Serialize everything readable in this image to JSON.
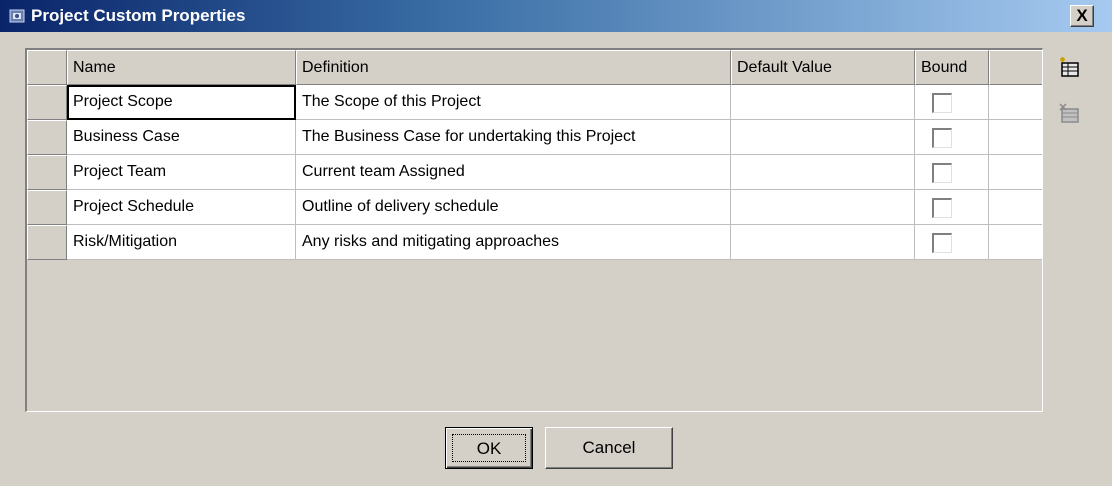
{
  "window": {
    "title": "Project Custom Properties",
    "close_label": "X"
  },
  "table": {
    "columns": [
      "Name",
      "Definition",
      "Default Value",
      "Bound"
    ],
    "rows": [
      {
        "name": "Project Scope",
        "definition": "The Scope of this Project",
        "default_value": "",
        "bound": false
      },
      {
        "name": "Business Case",
        "definition": "The Business Case for undertaking this Project",
        "default_value": "",
        "bound": false
      },
      {
        "name": "Project Team",
        "definition": "Current team Assigned",
        "default_value": "",
        "bound": false
      },
      {
        "name": "Project Schedule",
        "definition": "Outline of delivery schedule",
        "default_value": "",
        "bound": false
      },
      {
        "name": "Risk/Mitigation",
        "definition": "Any risks and mitigating approaches",
        "default_value": "",
        "bound": false
      }
    ]
  },
  "side_toolbar": {
    "add_icon": "add-property-icon",
    "delete_icon": "delete-property-icon"
  },
  "buttons": {
    "ok_label": "OK",
    "cancel_label": "Cancel"
  },
  "colors": {
    "dialog_bg": "#d4d0c8",
    "title_gradient_start": "#0a246a",
    "title_gradient_end": "#a6caf0"
  }
}
